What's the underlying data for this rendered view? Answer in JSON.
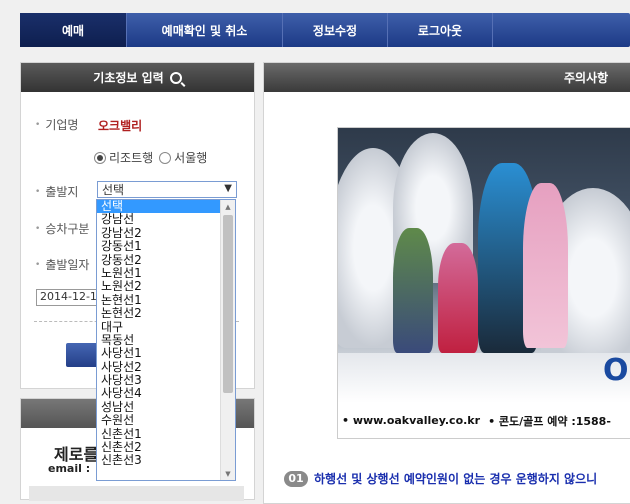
{
  "nav": {
    "tabs": [
      "예매",
      "예매확인 및 취소",
      "정보수정",
      "로그아웃"
    ]
  },
  "left_panel": {
    "title": "기초정보 입력",
    "company_label": "기업명",
    "company_value": "오크밸리",
    "radio_resort": "리조트행",
    "radio_seoul": "서울행",
    "radio_selected": "리조트행",
    "departure_label": "출발지",
    "departure_value": "선택",
    "boarding_label": "승차구분",
    "date_label": "출발일자",
    "date_value": "2014-12-1"
  },
  "dropdown": {
    "options": [
      "선택",
      "강남선",
      "강남선2",
      "강동선1",
      "강동선2",
      "노원선1",
      "노원선2",
      "논현선1",
      "논현선2",
      "대구",
      "목동선",
      "사당선1",
      "사당선2",
      "사당선3",
      "사당선4",
      "성남선",
      "수원선",
      "신촌선1",
      "신촌선2",
      "신촌선3"
    ],
    "selected_index": 0
  },
  "left_panel2": {
    "company_title": "제로를",
    "email_label": "email :"
  },
  "right_panel": {
    "title": "주의사항",
    "banner_url": "• www.oakvalley.co.kr",
    "banner_phone": "• 콘도/골프 예약 :1588-",
    "banner_letter": "O",
    "notice_number": "01",
    "notice_text": "하행선 및 상행선 예약인원이 없는 경우 운행하지 않으니"
  },
  "colors": {
    "nav_blue": "#1c3a86",
    "accent_red": "#b02020",
    "notice_blue": "#1a2fae",
    "highlight": "#3399ff"
  }
}
